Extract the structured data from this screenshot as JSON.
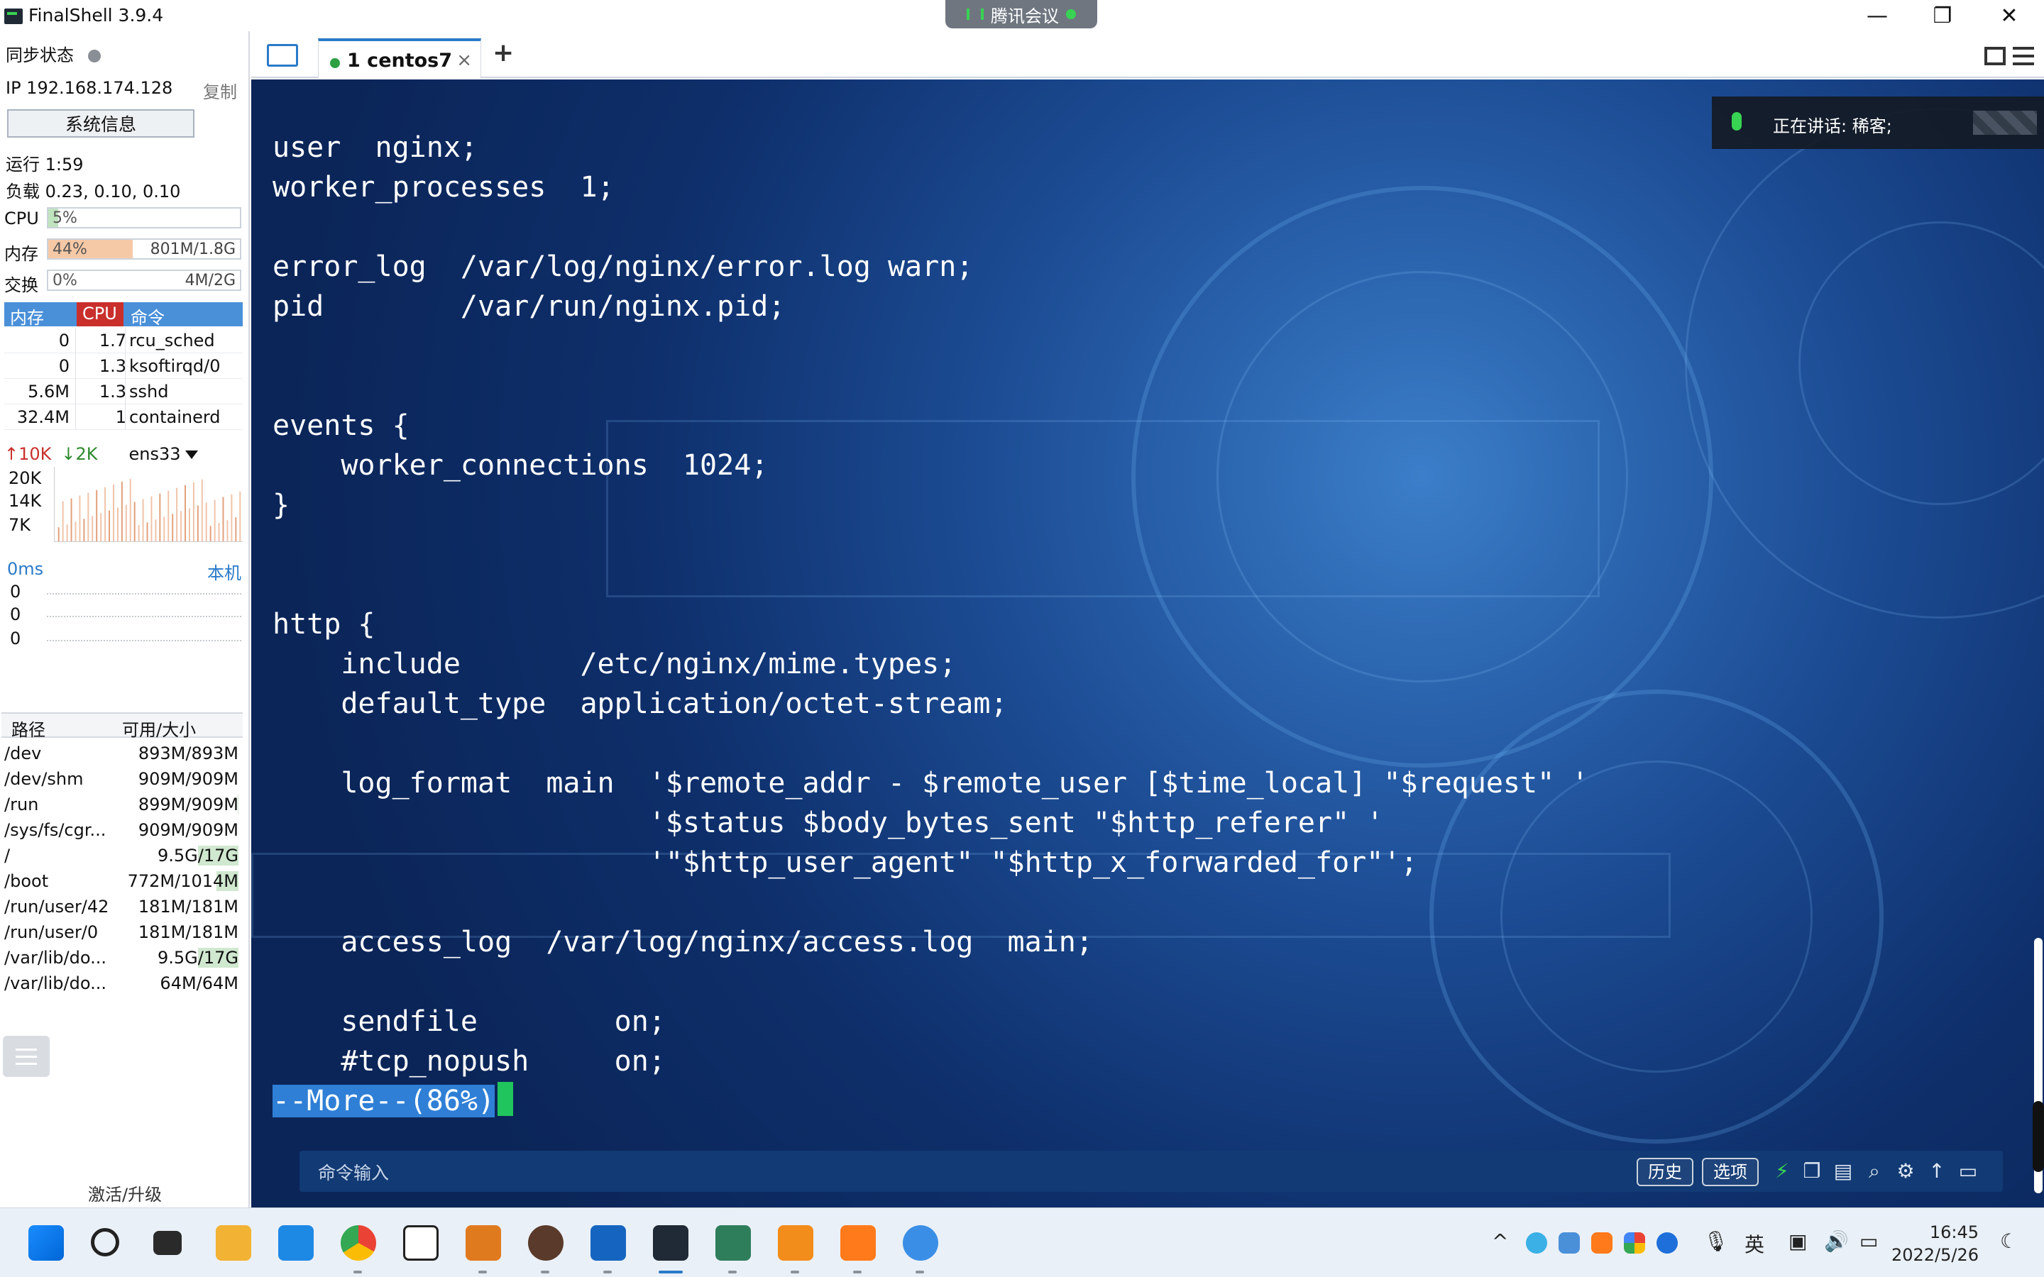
{
  "window": {
    "title": "FinalShell 3.9.4",
    "meeting_app": "腾讯会议",
    "minimize": "—",
    "maximize": "❐",
    "close": "✕"
  },
  "sidebar": {
    "sync_status": "同步状态",
    "ip": "IP 192.168.174.128",
    "copy": "复制",
    "sysinfo_button": "系统信息",
    "uptime": "运行 1:59",
    "load": "负载 0.23, 0.10, 0.10",
    "cpu": {
      "label": "CPU",
      "pct": "5%",
      "fill": 0.05
    },
    "mem": {
      "label": "内存",
      "pct": "44%",
      "amount": "801M/1.8G",
      "fill": 0.44
    },
    "swap": {
      "label": "交换",
      "pct": "0%",
      "amount": "4M/2G",
      "fill": 0.0
    },
    "proc_headers": {
      "mem": "内存",
      "cpu": "CPU",
      "cmd": "命令"
    },
    "processes": [
      {
        "mem": "0",
        "cpu": "1.7",
        "cmd": "rcu_sched"
      },
      {
        "mem": "0",
        "cpu": "1.3",
        "cmd": "ksoftirqd/0"
      },
      {
        "mem": "5.6M",
        "cpu": "1.3",
        "cmd": "sshd"
      },
      {
        "mem": "32.4M",
        "cpu": "1",
        "cmd": "containerd"
      }
    ],
    "net": {
      "up": "↑10K",
      "down": "↓2K",
      "iface": "ens33",
      "ticks": [
        "20K",
        "14K",
        "7K"
      ]
    },
    "ping": {
      "latency": "0ms",
      "target": "本机",
      "values": [
        "0",
        "0",
        "0"
      ]
    },
    "fs_headers": {
      "path": "路径",
      "size": "可用/大小"
    },
    "filesystems": [
      {
        "path": "/dev",
        "size": "893M/893M",
        "used": 0.0
      },
      {
        "path": "/dev/shm",
        "size": "909M/909M",
        "used": 0.0
      },
      {
        "path": "/run",
        "size": "899M/909M",
        "used": 0.01
      },
      {
        "path": "/sys/fs/cgr...",
        "size": "909M/909M",
        "used": 0.0
      },
      {
        "path": "/",
        "size": "9.5G/17G",
        "used": 0.44
      },
      {
        "path": "/boot",
        "size": "772M/1014M",
        "used": 0.24
      },
      {
        "path": "/run/user/42",
        "size": "181M/181M",
        "used": 0.0
      },
      {
        "path": "/run/user/0",
        "size": "181M/181M",
        "used": 0.0
      },
      {
        "path": "/var/lib/do...",
        "size": "9.5G/17G",
        "used": 0.44
      },
      {
        "path": "/var/lib/do...",
        "size": "64M/64M",
        "used": 0.0
      }
    ],
    "activate": "激活/升级"
  },
  "tabs": {
    "session_tab": "1 centos7",
    "close": "×",
    "add": "+"
  },
  "terminal": {
    "lines": [
      "user  nginx;",
      "worker_processes  1;",
      "",
      "error_log  /var/log/nginx/error.log warn;",
      "pid        /var/run/nginx.pid;",
      "",
      "",
      "events {",
      "    worker_connections  1024;",
      "}",
      "",
      "",
      "http {",
      "    include       /etc/nginx/mime.types;",
      "    default_type  application/octet-stream;",
      "",
      "    log_format  main  '$remote_addr - $remote_user [$time_local] \"$request\" '",
      "                      '$status $body_bytes_sent \"$http_referer\" '",
      "                      '\"$http_user_agent\" \"$http_x_forwarded_for\"';",
      "",
      "    access_log  /var/log/nginx/access.log  main;",
      "",
      "    sendfile        on;",
      "    #tcp_nopush     on;"
    ],
    "more_prompt": "--More--(86%)",
    "cmd_placeholder": "命令输入",
    "history_button": "历史",
    "options_button": "选项"
  },
  "speaking": {
    "text": "正在讲话: 稀客;"
  },
  "taskbar": {
    "tray_ime": "英",
    "time": "16:45",
    "date": "2022/5/26"
  }
}
